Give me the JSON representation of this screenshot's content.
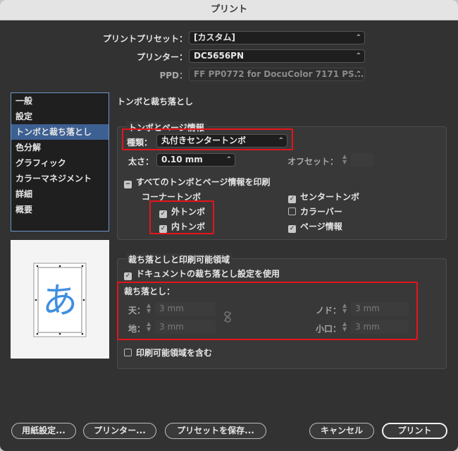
{
  "window": {
    "title": "プリント"
  },
  "top": {
    "preset_label": "プリントプリセット：",
    "preset_value": "[カスタム]",
    "printer_label": "プリンター：",
    "printer_value": "DC5656PN",
    "ppd_label": "PPD：",
    "ppd_value": "FF PP0772 for DocuColor 7171 PS..."
  },
  "sidebar": {
    "items": [
      {
        "label": "一般"
      },
      {
        "label": "設定"
      },
      {
        "label": "トンボと裁ち落とし"
      },
      {
        "label": "色分解"
      },
      {
        "label": "グラフィック"
      },
      {
        "label": "カラーマネジメント"
      },
      {
        "label": "詳細"
      },
      {
        "label": "概要"
      }
    ],
    "active_index": 2
  },
  "preview": {
    "glyph": "あ"
  },
  "panel": {
    "title": "トンボと裁ち落とし"
  },
  "marks": {
    "group_title": "トンボとページ情報",
    "type_label": "種類：",
    "type_value": "丸付きセンタートンボ",
    "weight_label": "太さ：",
    "weight_value": "0.10 mm",
    "offset_label": "オフセット：",
    "all_marks_label": "すべてのトンボとページ情報を印刷",
    "corner_label": "コーナートンボ",
    "outer_label": "外トンボ",
    "inner_label": "内トンボ",
    "center_label": "センタートンボ",
    "color_bar_label": "カラーバー",
    "page_info_label": "ページ情報"
  },
  "bleed": {
    "group_title": "裁ち落としと印刷可能領域",
    "use_doc_label": "ドキュメントの裁ち落とし設定を使用",
    "bleed_label": "裁ち落とし：",
    "top_label": "天：",
    "top_value": "3 mm",
    "bottom_label": "地：",
    "bottom_value": "3 mm",
    "inside_label": "ノド：",
    "inside_value": "3 mm",
    "outside_label": "小口：",
    "outside_value": "3 mm",
    "slug_label": "印刷可能領域を含む"
  },
  "buttons": {
    "page_setup": "用紙設定...",
    "printer": "プリンター...",
    "save_preset": "プリセットを保存...",
    "cancel": "キャンセル",
    "print": "プリント"
  },
  "colors": {
    "highlight": "#e5141c",
    "selection": "#3d6093"
  }
}
